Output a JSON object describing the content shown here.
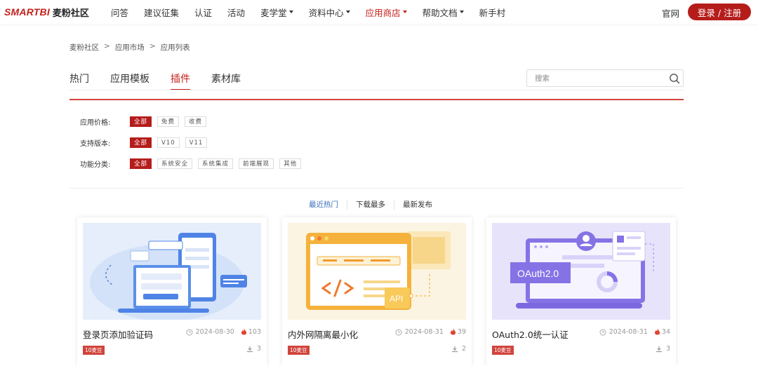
{
  "header": {
    "brand": "SMARTBI",
    "brand_cn": "麦粉社区",
    "nav": [
      {
        "label": "问答",
        "dropdown": false,
        "active": false
      },
      {
        "label": "建议征集",
        "dropdown": false,
        "active": false
      },
      {
        "label": "认证",
        "dropdown": false,
        "active": false
      },
      {
        "label": "活动",
        "dropdown": false,
        "active": false
      },
      {
        "label": "麦学堂",
        "dropdown": true,
        "active": false
      },
      {
        "label": "资料中心",
        "dropdown": true,
        "active": false
      },
      {
        "label": "应用商店",
        "dropdown": true,
        "active": true
      },
      {
        "label": "帮助文档",
        "dropdown": true,
        "active": false
      },
      {
        "label": "新手村",
        "dropdown": false,
        "active": false
      }
    ],
    "official": "官网",
    "login": "登录 / 注册"
  },
  "breadcrumb": [
    "麦粉社区",
    "应用市场",
    "应用列表"
  ],
  "tabs": [
    "热门",
    "应用模板",
    "插件",
    "素材库"
  ],
  "active_tab": "插件",
  "search": {
    "placeholder": "搜索"
  },
  "filters": [
    {
      "label": "应用价格:",
      "options": [
        "全部",
        "免费",
        "收费"
      ],
      "selected": "全部"
    },
    {
      "label": "支持版本:",
      "options": [
        "全部",
        "V10",
        "V11"
      ],
      "selected": "全部"
    },
    {
      "label": "功能分类:",
      "options": [
        "全部",
        "系统安全",
        "系统集成",
        "前端展现",
        "其他"
      ],
      "selected": "全部"
    }
  ],
  "sort": [
    "最近热门",
    "下载最多",
    "最新发布"
  ],
  "active_sort": "最近热门",
  "cards": [
    {
      "title": "登录页添加验证码",
      "date": "2024-08-30",
      "hot": "103",
      "badge": "10麦豆",
      "downloads": "3"
    },
    {
      "title": "内外网隔离最小化",
      "date": "2024-08-31",
      "hot": "39",
      "badge": "10麦豆",
      "downloads": "2"
    },
    {
      "title": "OAuth2.0统一认证",
      "date": "2024-08-31",
      "hot": "34",
      "badge": "10麦豆",
      "downloads": "3",
      "image_text": "OAuth2.0"
    }
  ],
  "card2_image_text": "API",
  "colors": {
    "brand_red": "#c4211c",
    "active_blue": "#3a6fb7",
    "badge_red": "#d0443c"
  }
}
